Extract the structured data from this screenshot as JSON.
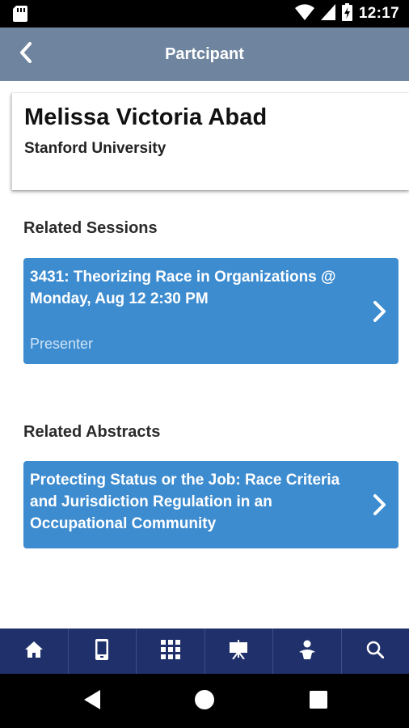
{
  "status_bar": {
    "time": "12:17",
    "icons": [
      "sd-card-icon",
      "wifi-icon",
      "signal-icon",
      "battery-charging-icon"
    ]
  },
  "header": {
    "title": "Partcipant",
    "back_icon": "chevron-left-icon"
  },
  "participant": {
    "name": "Melissa Victoria Abad",
    "organization": "Stanford University"
  },
  "related_sessions": {
    "heading": "Related Sessions",
    "items": [
      {
        "title": "3431: Theorizing Race in Organizations @ Monday, Aug 12 2:30 PM",
        "role": "Presenter"
      }
    ]
  },
  "related_abstracts": {
    "heading": "Related Abstracts",
    "items": [
      {
        "title": "Protecting Status or the Job: Race Criteria and Jurisdiction Regulation in an Occupational Community"
      }
    ]
  },
  "tab_bar": {
    "tabs": [
      "home-icon",
      "mobile-device-icon",
      "grid-icon",
      "presentation-board-icon",
      "person-icon",
      "search-icon"
    ]
  },
  "nav_bar": {
    "buttons": [
      "back-triangle-icon",
      "home-circle-icon",
      "recents-square-icon"
    ]
  },
  "colors": {
    "header_bg": "#6f859f",
    "card_blue": "#3d8cd0",
    "tab_bar_bg": "#20306a",
    "role_text": "#cfe3f5"
  }
}
